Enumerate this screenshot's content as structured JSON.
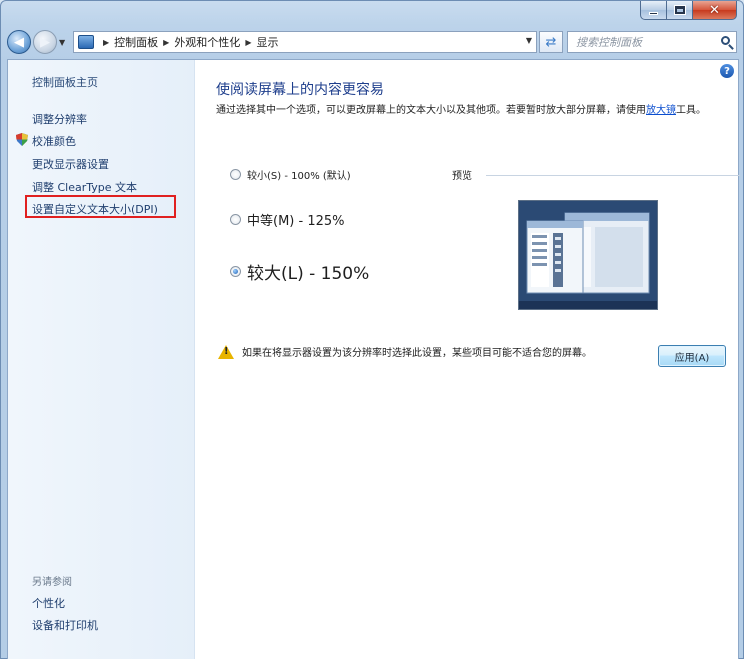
{
  "window": {
    "caption_min": "–",
    "caption_close": "✕"
  },
  "nav": {
    "back_glyph": "◀",
    "forward_glyph": "▶",
    "breadcrumbs": [
      "控制面板",
      "外观和个性化",
      "显示"
    ],
    "refresh_glyph": "⇄",
    "search_placeholder": "搜索控制面板"
  },
  "sidebar": {
    "home": "控制面板主页",
    "items": [
      "调整分辨率",
      "校准颜色",
      "更改显示器设置",
      "调整 ClearType 文本",
      "设置自定义文本大小(DPI)"
    ],
    "see_also_heading": "另请参阅",
    "see_also": [
      "个性化",
      "设备和打印机"
    ]
  },
  "main": {
    "help_glyph": "?",
    "title": "使阅读屏幕上的内容更容易",
    "description_before": "通过选择其中一个选项，可以更改屏幕上的文本大小以及其他项。若要暂时放大部分屏幕，请使用",
    "description_link": "放大镜",
    "description_after": "工具。",
    "options": [
      {
        "label": "较小(S) - 100% (默认)",
        "checked": false
      },
      {
        "label": "中等(M) - 125%",
        "checked": false
      },
      {
        "label": "较大(L) - 150%",
        "checked": true
      }
    ],
    "preview_label": "预览",
    "warning": "如果在将显示器设置为该分辨率时选择此设置，某些项目可能不适合您的屏幕。",
    "apply_label": "应用(A)"
  },
  "colors": {
    "link": "#1f3e6e",
    "title": "#1e3e8c",
    "highlight": "#e02020"
  }
}
